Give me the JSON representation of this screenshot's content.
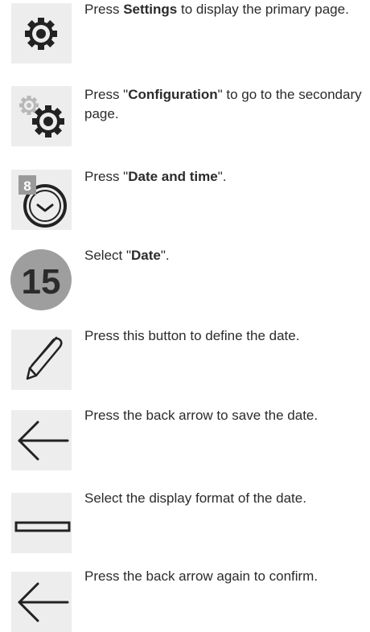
{
  "steps": [
    {
      "icon": "gear-icon",
      "pre": "Press ",
      "bold": "Settings",
      "post": " to display the primary page."
    },
    {
      "icon": "double-gear-icon",
      "pre": "Press \"",
      "bold": "Configuration",
      "post": "\" to go to the secondary page."
    },
    {
      "icon": "clock-icon",
      "badge": "8",
      "pre": "Press \"",
      "bold": "Date and time",
      "post": "\"."
    },
    {
      "icon": "date-number-icon",
      "number": "15",
      "pre": "Select \"",
      "bold": "Date",
      "post": "\"."
    },
    {
      "icon": "pencil-icon",
      "pre": "Press this button to define the date.",
      "bold": "",
      "post": ""
    },
    {
      "icon": "back-arrow-icon",
      "pre": "Press the back arrow to save the date.",
      "bold": "",
      "post": ""
    },
    {
      "icon": "display-format-icon",
      "pre": "Select the display format of the date.",
      "bold": "",
      "post": ""
    },
    {
      "icon": "back-arrow-icon",
      "pre": "Press the back arrow again to confirm.",
      "bold": "",
      "post": ""
    }
  ]
}
